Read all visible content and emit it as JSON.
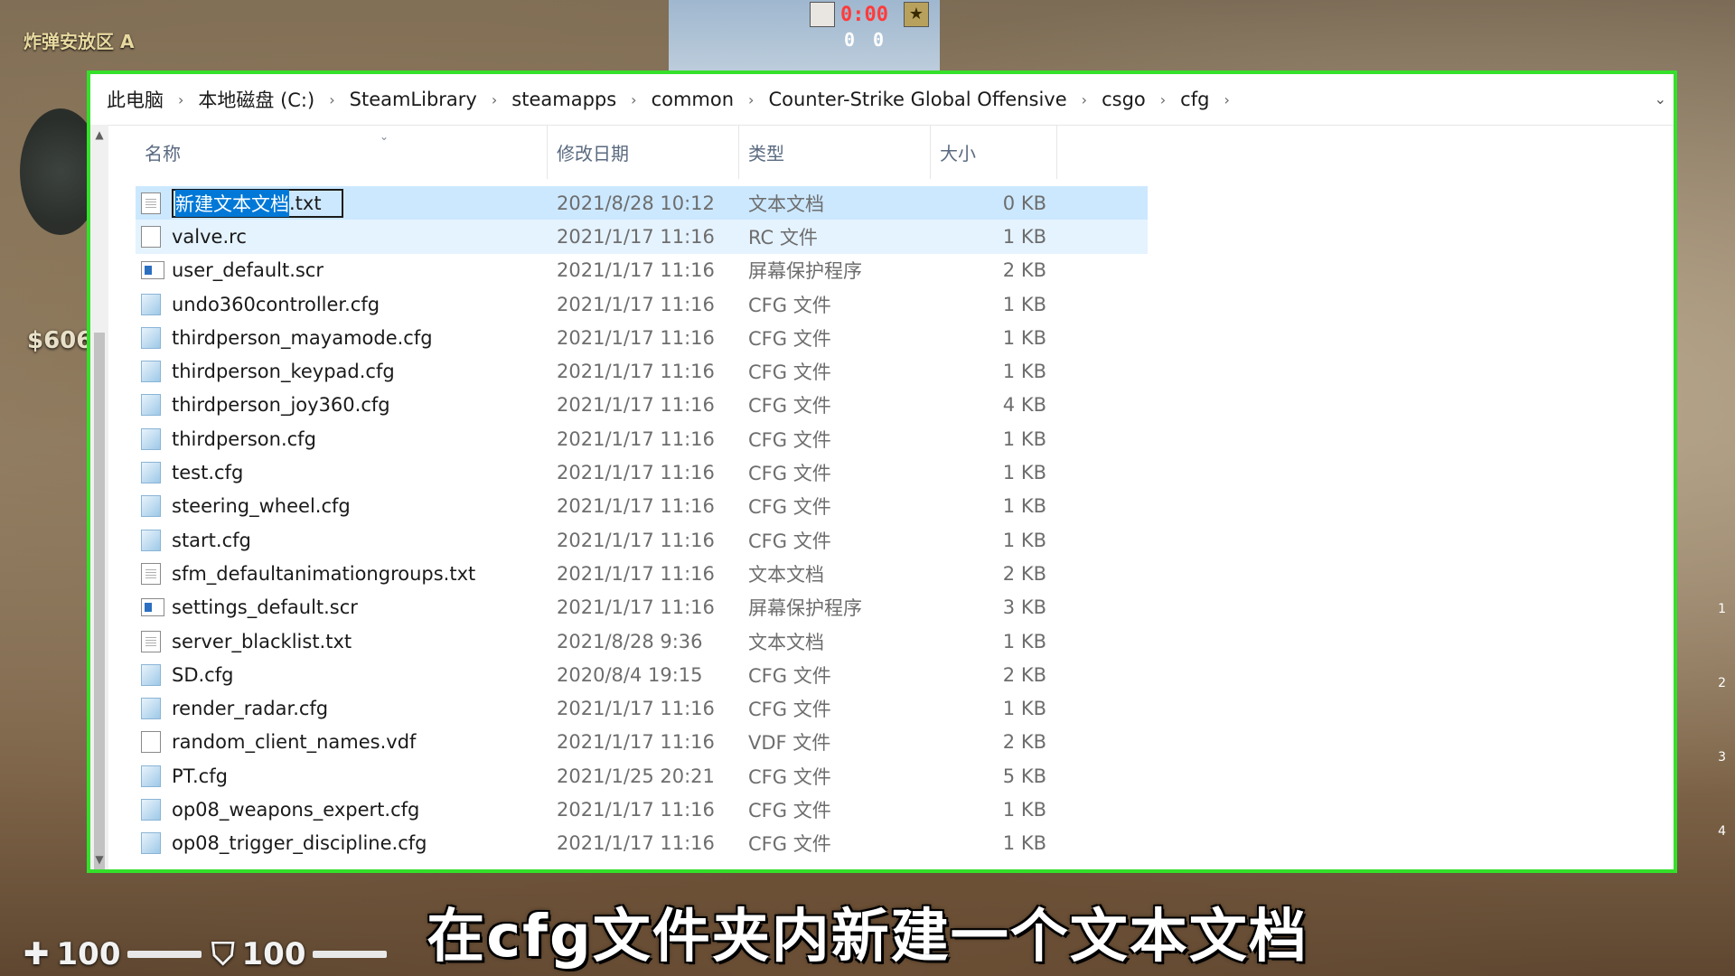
{
  "hud": {
    "zone": "炸弹安放区 A",
    "money": "$606",
    "timer": "0:00",
    "score_ct": "0",
    "score_t": "0",
    "health": "100",
    "armor": "100",
    "slots": [
      "1",
      "2",
      "3",
      "4"
    ]
  },
  "caption": "在cfg文件夹内新建一个文本文档",
  "breadcrumb": [
    "此电脑",
    "本地磁盘 (C:)",
    "SteamLibrary",
    "steamapps",
    "common",
    "Counter-Strike Global Offensive",
    "csgo",
    "cfg"
  ],
  "columns": {
    "name": "名称",
    "date": "修改日期",
    "type": "类型",
    "size": "大小"
  },
  "rename": {
    "selected_part": "新建文本文档",
    "extension": ".txt"
  },
  "files": [
    {
      "name": "新建文本文档.txt",
      "date": "2021/8/28 10:12",
      "type": "文本文档",
      "size": "0 KB",
      "icon": "txt-file-icon"
    },
    {
      "name": "valve.rc",
      "date": "2021/1/17 11:16",
      "type": "RC 文件",
      "size": "1 KB",
      "icon": "plain-file-icon"
    },
    {
      "name": "user_default.scr",
      "date": "2021/1/17 11:16",
      "type": "屏幕保护程序",
      "size": "2 KB",
      "icon": "screensaver-icon"
    },
    {
      "name": "undo360controller.cfg",
      "date": "2021/1/17 11:16",
      "type": "CFG 文件",
      "size": "1 KB",
      "icon": "cfg-file-icon"
    },
    {
      "name": "thirdperson_mayamode.cfg",
      "date": "2021/1/17 11:16",
      "type": "CFG 文件",
      "size": "1 KB",
      "icon": "cfg-file-icon"
    },
    {
      "name": "thirdperson_keypad.cfg",
      "date": "2021/1/17 11:16",
      "type": "CFG 文件",
      "size": "1 KB",
      "icon": "cfg-file-icon"
    },
    {
      "name": "thirdperson_joy360.cfg",
      "date": "2021/1/17 11:16",
      "type": "CFG 文件",
      "size": "4 KB",
      "icon": "cfg-file-icon"
    },
    {
      "name": "thirdperson.cfg",
      "date": "2021/1/17 11:16",
      "type": "CFG 文件",
      "size": "1 KB",
      "icon": "cfg-file-icon"
    },
    {
      "name": "test.cfg",
      "date": "2021/1/17 11:16",
      "type": "CFG 文件",
      "size": "1 KB",
      "icon": "cfg-file-icon"
    },
    {
      "name": "steering_wheel.cfg",
      "date": "2021/1/17 11:16",
      "type": "CFG 文件",
      "size": "1 KB",
      "icon": "cfg-file-icon"
    },
    {
      "name": "start.cfg",
      "date": "2021/1/17 11:16",
      "type": "CFG 文件",
      "size": "1 KB",
      "icon": "cfg-file-icon"
    },
    {
      "name": "sfm_defaultanimationgroups.txt",
      "date": "2021/1/17 11:16",
      "type": "文本文档",
      "size": "2 KB",
      "icon": "txt-file-icon"
    },
    {
      "name": "settings_default.scr",
      "date": "2021/1/17 11:16",
      "type": "屏幕保护程序",
      "size": "3 KB",
      "icon": "screensaver-icon"
    },
    {
      "name": "server_blacklist.txt",
      "date": "2021/8/28 9:36",
      "type": "文本文档",
      "size": "1 KB",
      "icon": "txt-file-icon"
    },
    {
      "name": "SD.cfg",
      "date": "2020/8/4 19:15",
      "type": "CFG 文件",
      "size": "2 KB",
      "icon": "cfg-file-icon"
    },
    {
      "name": "render_radar.cfg",
      "date": "2021/1/17 11:16",
      "type": "CFG 文件",
      "size": "1 KB",
      "icon": "cfg-file-icon"
    },
    {
      "name": "random_client_names.vdf",
      "date": "2021/1/17 11:16",
      "type": "VDF 文件",
      "size": "2 KB",
      "icon": "plain-file-icon"
    },
    {
      "name": "PT.cfg",
      "date": "2021/1/25 20:21",
      "type": "CFG 文件",
      "size": "5 KB",
      "icon": "cfg-file-icon"
    },
    {
      "name": "op08_weapons_expert.cfg",
      "date": "2021/1/17 11:16",
      "type": "CFG 文件",
      "size": "1 KB",
      "icon": "cfg-file-icon"
    },
    {
      "name": "op08_trigger_discipline.cfg",
      "date": "2021/1/17 11:16",
      "type": "CFG 文件",
      "size": "1 KB",
      "icon": "cfg-file-icon"
    }
  ],
  "colors": {
    "window_border": "#34e02a",
    "selection": "#cce8ff",
    "rename_highlight": "#0078d7",
    "timer": "#ff3b3b"
  }
}
